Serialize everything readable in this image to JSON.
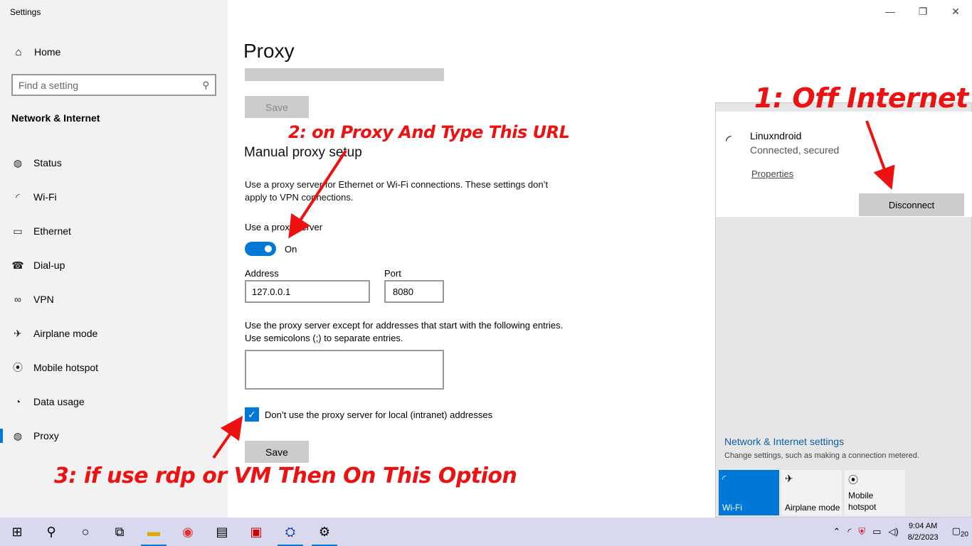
{
  "app": {
    "title": "Settings"
  },
  "sidebar": {
    "home": {
      "label": "Home",
      "icon": "home-icon"
    },
    "search_placeholder": "Find a setting",
    "section_title": "Network & Internet",
    "items": [
      {
        "label": "Status",
        "icon": "globe-icon",
        "glyph": "🌐"
      },
      {
        "label": "Wi-Fi",
        "icon": "wifi-icon",
        "glyph": "📶"
      },
      {
        "label": "Ethernet",
        "icon": "ethernet-icon",
        "glyph": "🖳"
      },
      {
        "label": "Dial-up",
        "icon": "dialup-icon",
        "glyph": "☎"
      },
      {
        "label": "VPN",
        "icon": "vpn-icon",
        "glyph": "⚯"
      },
      {
        "label": "Airplane mode",
        "icon": "airplane-icon",
        "glyph": "✈"
      },
      {
        "label": "Mobile hotspot",
        "icon": "hotspot-icon",
        "glyph": "((·))"
      },
      {
        "label": "Data usage",
        "icon": "data-usage-icon",
        "glyph": "◔"
      },
      {
        "label": "Proxy",
        "icon": "proxy-globe-icon",
        "glyph": "🌐"
      }
    ]
  },
  "main": {
    "title": "Proxy",
    "save_top": "Save",
    "manual_title": "Manual proxy setup",
    "manual_desc": "Use a proxy server for Ethernet or Wi-Fi connections. These settings don’t apply to VPN connections.",
    "use_proxy_label": "Use a proxy server",
    "toggle_state": "On",
    "address_label": "Address",
    "address_value": "127.0.0.1",
    "port_label": "Port",
    "port_value": "8080",
    "exceptions_desc": "Use the proxy server except for addresses that start with the following entries. Use semicolons (;) to separate entries.",
    "exceptions_value": "",
    "local_checkbox_label": "Don’t use the proxy server for local (intranet) addresses",
    "local_checkbox_checked": true,
    "save_bottom": "Save"
  },
  "flyout": {
    "network_name": "Linuxndroid",
    "network_status": "Connected, secured",
    "properties": "Properties",
    "disconnect": "Disconnect",
    "settings_title": "Network & Internet settings",
    "settings_sub": "Change settings, such as making a connection metered.",
    "quick_actions": [
      {
        "label": "Wi-Fi",
        "active": true
      },
      {
        "label": "Airplane mode",
        "active": false
      },
      {
        "label": "Mobile hotspot",
        "active": false
      }
    ]
  },
  "annotations": {
    "one": "1: Off Internet",
    "two": "2: on Proxy And Type This URL",
    "three": "3: if use rdp or VM Then On This Option",
    "color": "#ee1111"
  },
  "taskbar": {
    "time": "9:04 AM",
    "date": "8/2/2023",
    "notification_count": "20"
  },
  "colors": {
    "accent": "#0078d7",
    "sidebar_bg": "#f2f2f2",
    "taskbar_bg": "#d8d8ee"
  }
}
